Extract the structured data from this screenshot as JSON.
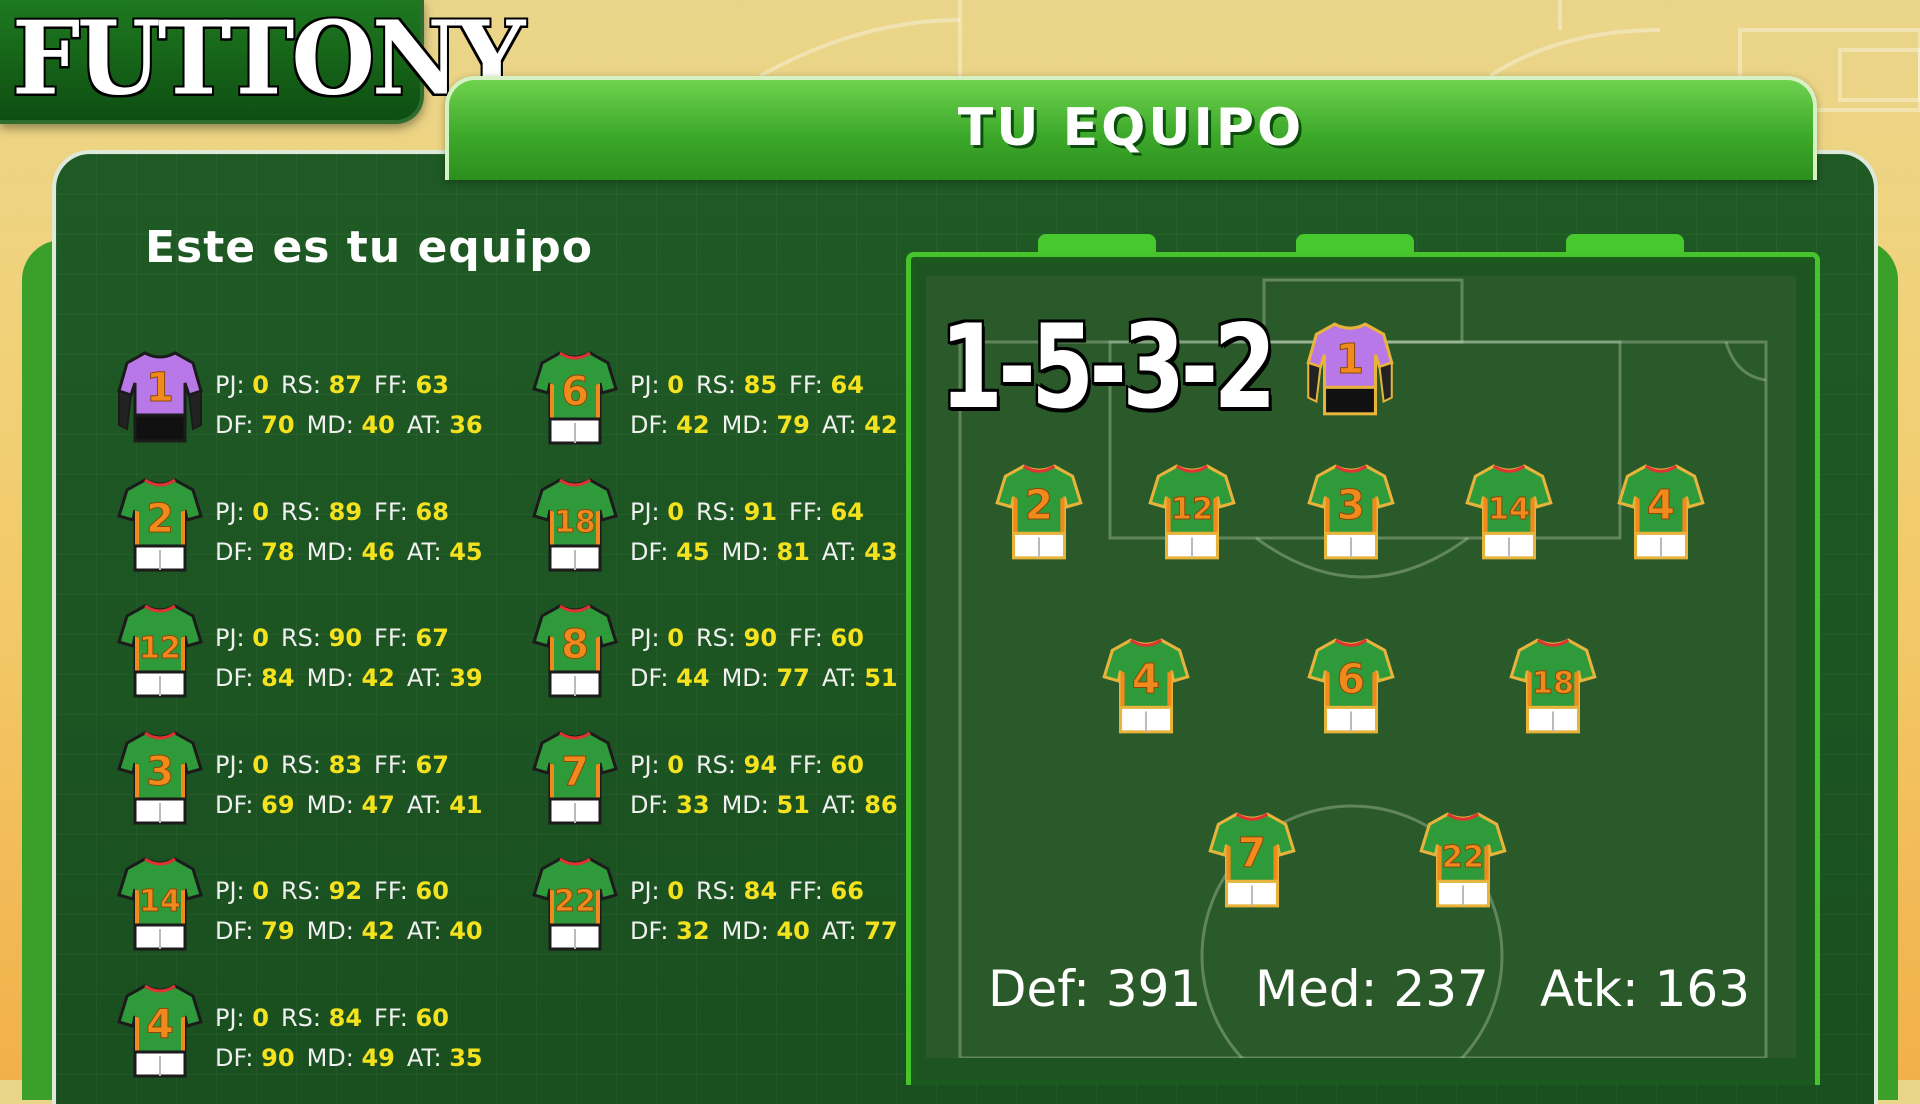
{
  "app": {
    "logo": "FUTTONY"
  },
  "header": {
    "title": "TU EQUIPO"
  },
  "subtitle": "Este es tu equipo",
  "colors": {
    "shirt_green": "#2e9a3a",
    "shirt_orange": "#f08a1c",
    "shirt_white": "#ffffff",
    "gk_purple": "#b878e8",
    "stat_value": "#f4e21e"
  },
  "players": [
    {
      "number": "1",
      "kind": "gk",
      "pj": "0",
      "rs": "87",
      "ff": "63",
      "df": "70",
      "md": "40",
      "at": "36"
    },
    {
      "number": "2",
      "kind": "field",
      "pj": "0",
      "rs": "89",
      "ff": "68",
      "df": "78",
      "md": "46",
      "at": "45"
    },
    {
      "number": "12",
      "kind": "field",
      "pj": "0",
      "rs": "90",
      "ff": "67",
      "df": "84",
      "md": "42",
      "at": "39"
    },
    {
      "number": "3",
      "kind": "field",
      "pj": "0",
      "rs": "83",
      "ff": "67",
      "df": "69",
      "md": "47",
      "at": "41"
    },
    {
      "number": "14",
      "kind": "field",
      "pj": "0",
      "rs": "92",
      "ff": "60",
      "df": "79",
      "md": "42",
      "at": "40"
    },
    {
      "number": "4",
      "kind": "field",
      "pj": "0",
      "rs": "84",
      "ff": "60",
      "df": "90",
      "md": "49",
      "at": "35"
    },
    {
      "number": "6",
      "kind": "field",
      "pj": "0",
      "rs": "85",
      "ff": "64",
      "df": "42",
      "md": "79",
      "at": "42"
    },
    {
      "number": "18",
      "kind": "field",
      "pj": "0",
      "rs": "91",
      "ff": "64",
      "df": "45",
      "md": "81",
      "at": "43"
    },
    {
      "number": "8",
      "kind": "field",
      "pj": "0",
      "rs": "90",
      "ff": "60",
      "df": "44",
      "md": "77",
      "at": "51"
    },
    {
      "number": "7",
      "kind": "field",
      "pj": "0",
      "rs": "94",
      "ff": "60",
      "df": "33",
      "md": "51",
      "at": "86"
    },
    {
      "number": "22",
      "kind": "field",
      "pj": "0",
      "rs": "84",
      "ff": "66",
      "df": "32",
      "md": "40",
      "at": "77"
    }
  ],
  "stat_labels": {
    "pj": "PJ:",
    "rs": "RS:",
    "ff": "FF:",
    "df": "DF:",
    "md": "MD:",
    "at": "AT:"
  },
  "field": {
    "formation": "1-5-3-2",
    "goalkeeper": "1",
    "defenders": [
      "2",
      "12",
      "3",
      "14",
      "4"
    ],
    "midfielders": [
      "4",
      "6",
      "18"
    ],
    "forwards": [
      "7",
      "22"
    ]
  },
  "totals": {
    "def": "Def: 391",
    "med": "Med: 237",
    "atk": "Atk: 163"
  }
}
